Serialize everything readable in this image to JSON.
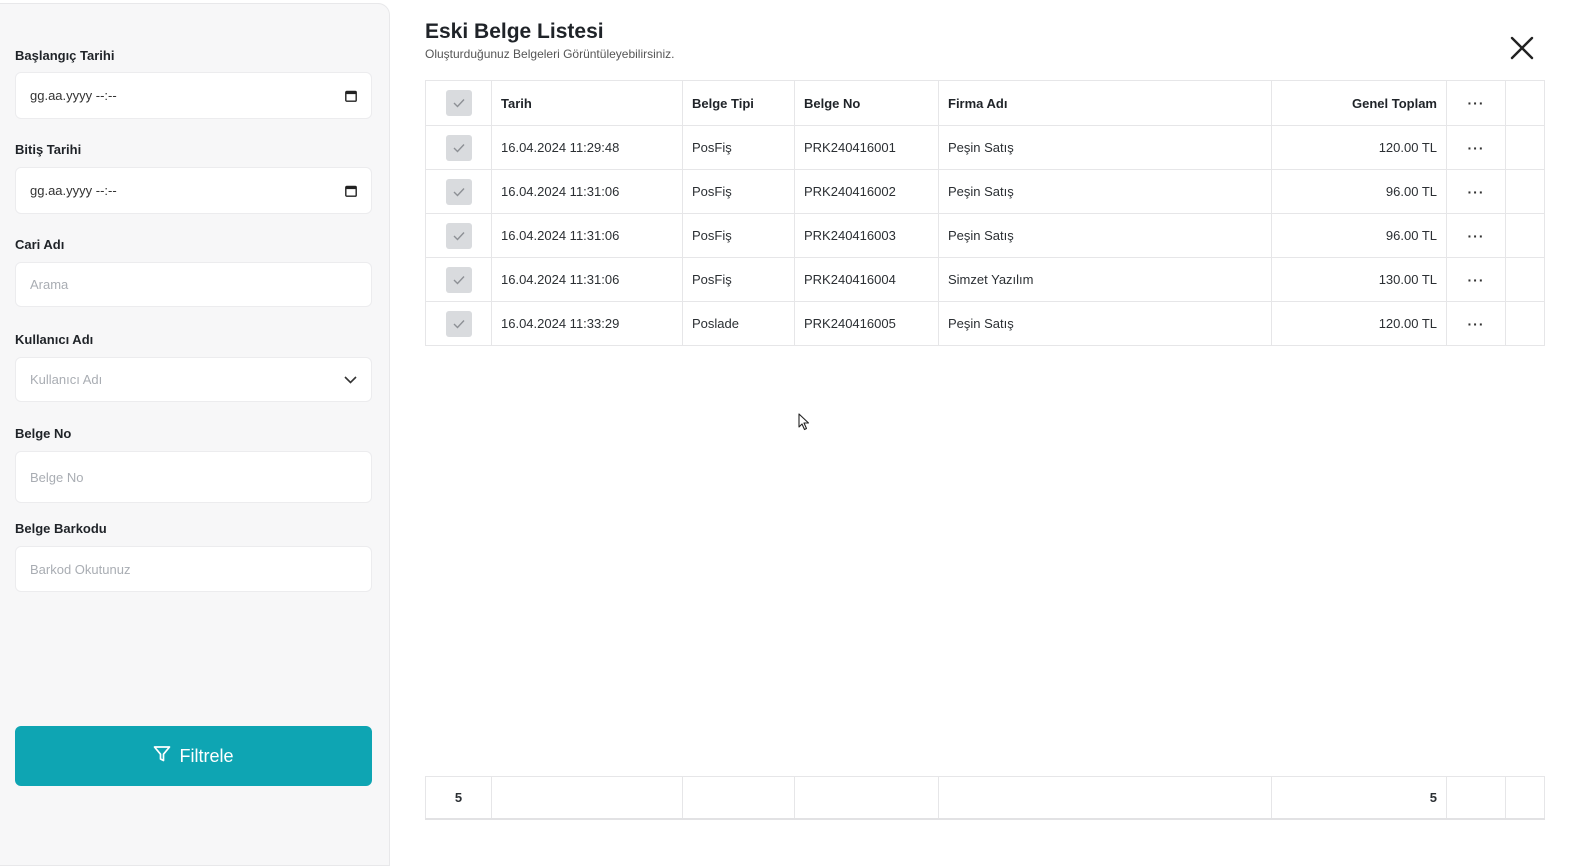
{
  "filters": {
    "start_date": {
      "label": "Başlangıç Tarihi",
      "value": "gg.aa.yyyy --:--",
      "icon": "calendar-icon"
    },
    "end_date": {
      "label": "Bitiş Tarihi",
      "value": "gg.aa.yyyy --:--",
      "icon": "calendar-icon"
    },
    "account_name": {
      "label": "Cari Adı",
      "placeholder": "Arama"
    },
    "user_name": {
      "label": "Kullanıcı Adı",
      "placeholder": "Kullanıcı Adı",
      "icon": "chevron-down-icon"
    },
    "document_no": {
      "label": "Belge No",
      "placeholder": "Belge No"
    },
    "document_barcode": {
      "label": "Belge Barkodu",
      "placeholder": "Barkod Okutunuz"
    },
    "filter_button": {
      "label": "Filtrele",
      "icon": "filter-icon"
    }
  },
  "main": {
    "title": "Eski Belge Listesi",
    "subtitle": "Oluşturduğunuz Belgeleri Görüntüleyebilirsiniz.",
    "close_icon": "close-icon"
  },
  "table": {
    "columns": {
      "date": "Tarih",
      "type": "Belge Tipi",
      "no": "Belge No",
      "firm": "Firma Adı",
      "total": "Genel Toplam",
      "actions": "···"
    },
    "rows": [
      {
        "date": "16.04.2024 11:29:48",
        "type": "PosFiş",
        "no": "PRK240416001",
        "firm": "Peşin Satış",
        "total": "120.00 TL",
        "actions": "···"
      },
      {
        "date": "16.04.2024 11:31:06",
        "type": "PosFiş",
        "no": "PRK240416002",
        "firm": "Peşin Satış",
        "total": "96.00 TL",
        "actions": "···"
      },
      {
        "date": "16.04.2024 11:31:06",
        "type": "PosFiş",
        "no": "PRK240416003",
        "firm": "Peşin Satış",
        "total": "96.00 TL",
        "actions": "···"
      },
      {
        "date": "16.04.2024 11:31:06",
        "type": "PosFiş",
        "no": "PRK240416004",
        "firm": "Simzet Yazılım",
        "total": "130.00 TL",
        "actions": "···"
      },
      {
        "date": "16.04.2024 11:33:29",
        "type": "Poslade",
        "no": "PRK240416005",
        "firm": "Peşin Satış",
        "total": "120.00 TL",
        "actions": "···"
      }
    ],
    "footer": {
      "count": "5",
      "total_count": "5"
    }
  },
  "colors": {
    "accent": "#0ea5b3",
    "checkbox": "#d9dbde",
    "sidebar_bg": "#f7f7f8"
  }
}
